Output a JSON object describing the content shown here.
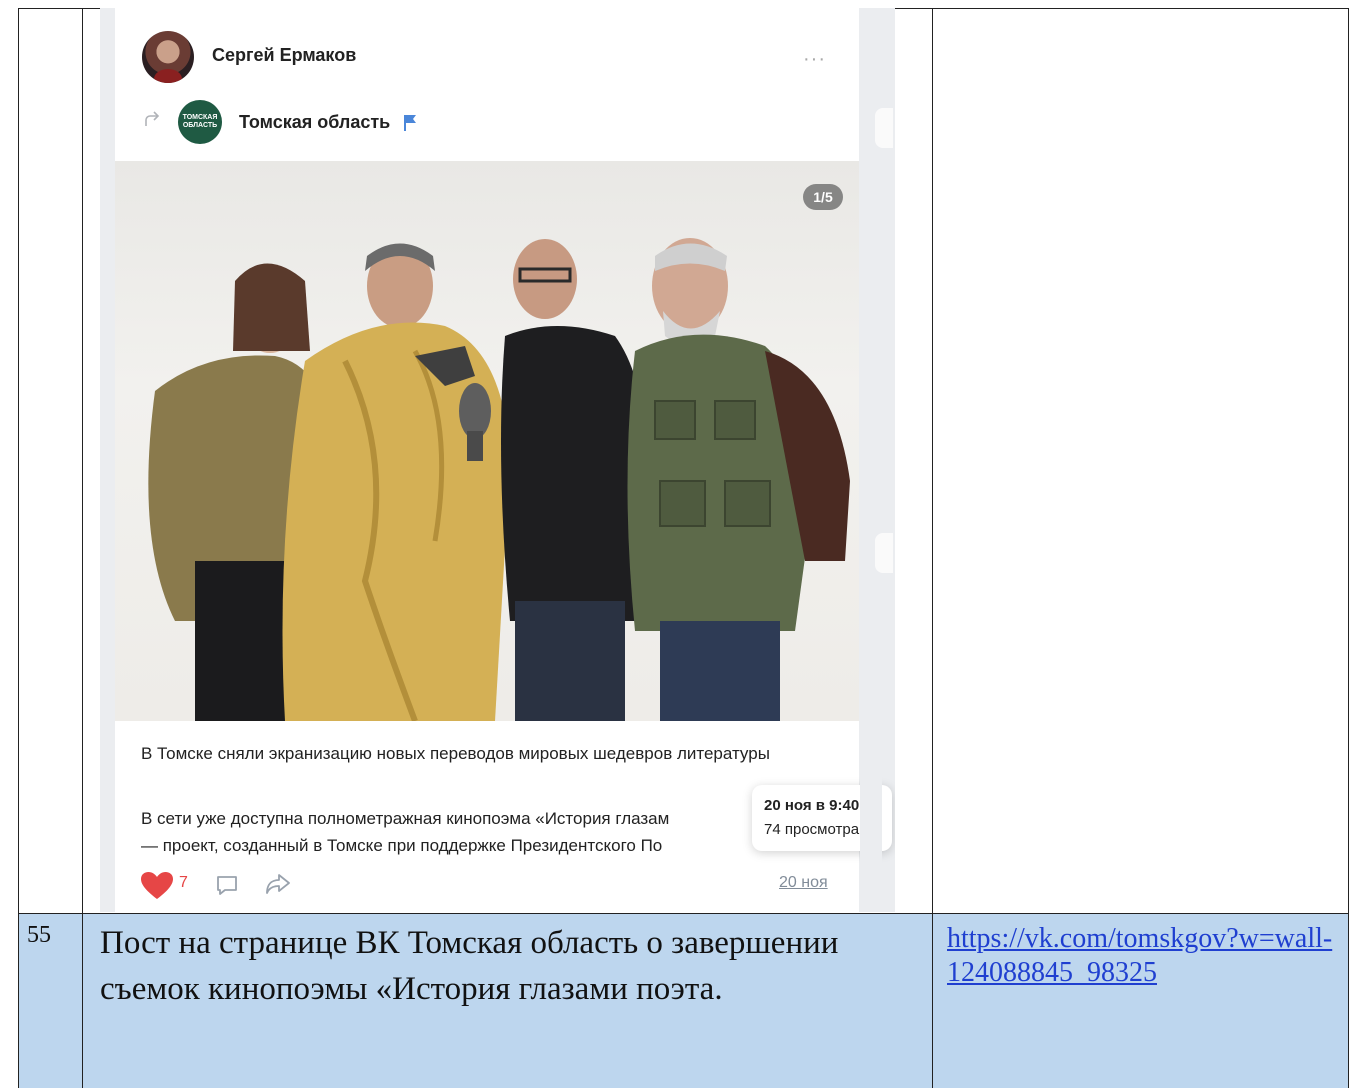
{
  "table": {
    "row_number": "55",
    "description": "Пост на странице ВК Томская область о завершении съемок кинопоэмы «История глазами поэта.",
    "link": "https://vk.com/tomskgov?w=wall-124088845_98325"
  },
  "post": {
    "author": "Сергей Ермаков",
    "more_label": "···",
    "repost_group": "Томская область",
    "group_logo_text": "ТОМСКАЯ ОБЛАСТЬ",
    "photo_counter": "1/5",
    "title": "В Томске сняли экранизацию новых переводов мировых шедевров литературы",
    "body_line1": "В сети уже доступна полнометражная кинопоэма «История глазам",
    "body_line2": "— проект, созданный в Томске при поддержке Президентского По",
    "tooltip_date": "20 ноя в 9:40",
    "tooltip_views": "74 просмотра",
    "likes": "7",
    "date": "20 ноя"
  },
  "colors": {
    "table_highlight": "#bdd6ee",
    "link": "#1f3fd0",
    "like": "#e64646",
    "group_logo": "#1f5a43",
    "flag": "#4a86d9"
  },
  "icons": [
    "more-icon",
    "repost-icon",
    "flag-icon",
    "heart-icon",
    "comment-icon",
    "share-icon"
  ]
}
